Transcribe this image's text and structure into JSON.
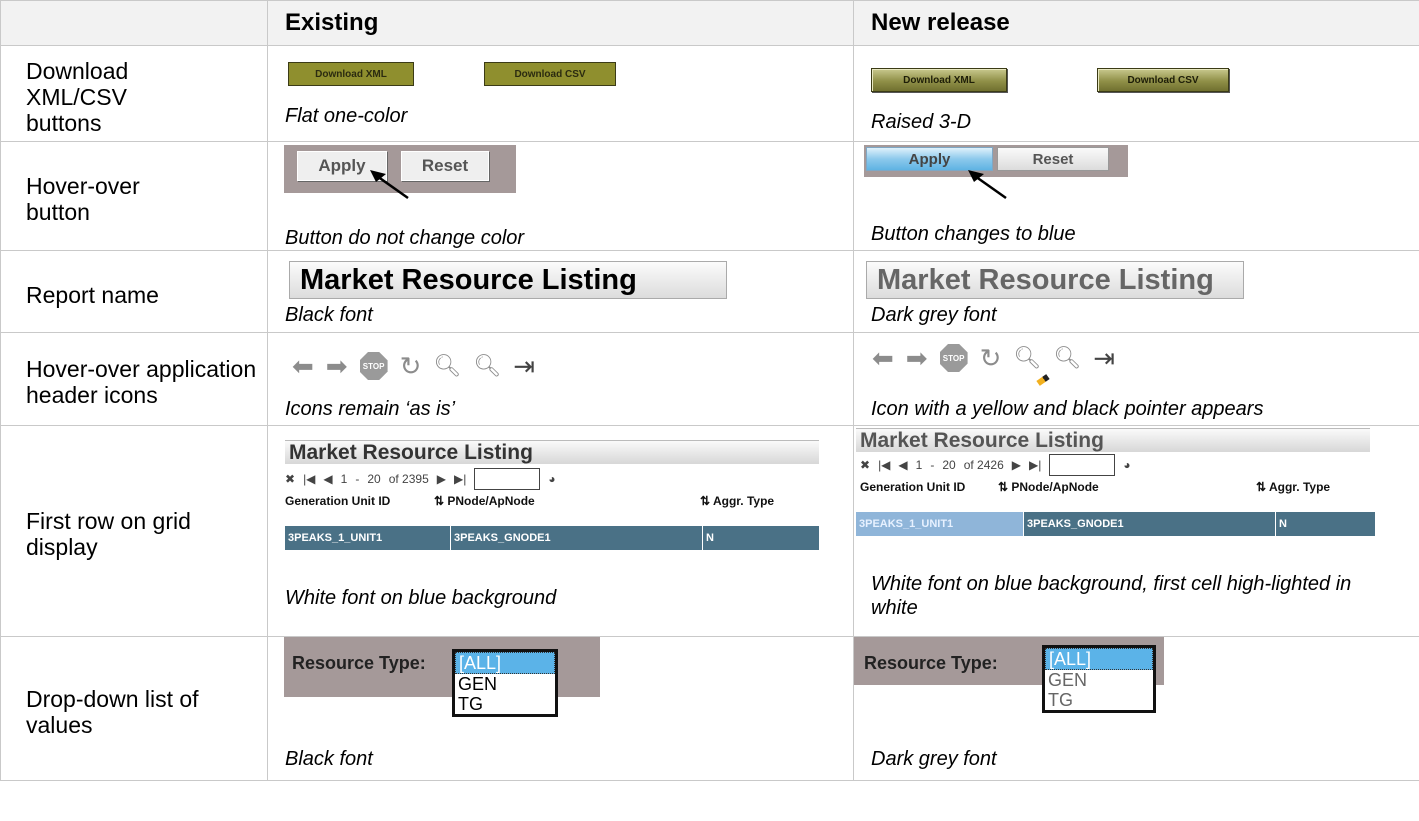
{
  "header": {
    "existing": "Existing",
    "new_release": "New release"
  },
  "rows": {
    "download": {
      "label": "Download XML/CSV buttons",
      "xml_label": "Download XML",
      "csv_label": "Download CSV",
      "existing_caption": "Flat one-color",
      "new_caption": "Raised 3-D"
    },
    "hover_button": {
      "label": "Hover-over button",
      "apply_label": "Apply",
      "reset_label": "Reset",
      "existing_caption": "Button do not change color",
      "new_caption": "Button changes to blue"
    },
    "report_name": {
      "label": "Report name",
      "title": "Market Resource Listing",
      "existing_caption": "Black font",
      "new_caption": "Dark grey font"
    },
    "header_icons": {
      "label": "Hover-over application header icons",
      "stop_text": "STOP",
      "existing_caption": "Icons remain ‘as is’",
      "new_caption": "Icon with a yellow and black pointer appears"
    },
    "grid": {
      "label": "First row on grid display",
      "title": "Market Resource Listing",
      "existing_pager": {
        "from": "1",
        "dash": "-",
        "to": "20",
        "of": "of 2395"
      },
      "new_pager": {
        "from": "1",
        "dash": "-",
        "to": "20",
        "of": "of 2426"
      },
      "col1": "Generation Unit ID",
      "col2": "PNode/ApNode",
      "col3": "Aggr. Type",
      "cell1": "3PEAKS_1_UNIT1",
      "cell2": "3PEAKS_GNODE1",
      "cell3": "N",
      "existing_caption": "White font on blue background",
      "new_caption": "White font on blue background, first cell high-lighted in white"
    },
    "dropdown": {
      "label": "Drop-down list of values",
      "field_label": "Resource Type:",
      "options": [
        "[ALL]",
        "GEN",
        "TG"
      ],
      "existing_caption": "Black font",
      "new_caption": "Dark grey font"
    }
  },
  "colors": {
    "grid_row": "#4a7186",
    "button_olive": "#8f8f2e",
    "hover_blue": "#5fb3e3"
  }
}
